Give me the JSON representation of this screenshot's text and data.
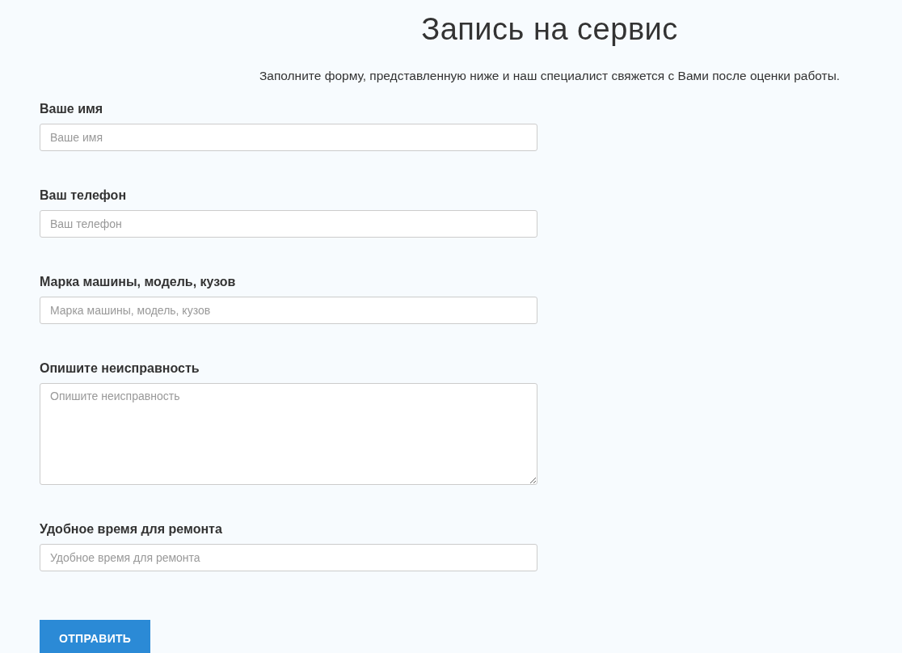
{
  "header": {
    "title": "Запись на сервис",
    "subtitle": "Заполните форму, представленную ниже и наш специалист свяжется с Вами после оценки работы."
  },
  "fields": [
    {
      "kind": "input",
      "label": "Ваше имя",
      "placeholder": "Ваше имя"
    },
    {
      "kind": "input",
      "label": "Ваш телефон",
      "placeholder": "Ваш телефон"
    },
    {
      "kind": "input",
      "label": "Марка машины, модель, кузов",
      "placeholder": "Марка машины, модель, кузов"
    },
    {
      "kind": "textarea",
      "label": "Опишите неисправность",
      "placeholder": "Опишите неисправность"
    },
    {
      "kind": "input",
      "label": "Удобное время для ремонта",
      "placeholder": "Удобное время для ремонта"
    }
  ],
  "submit": {
    "label": "ОТПРАВИТЬ"
  }
}
